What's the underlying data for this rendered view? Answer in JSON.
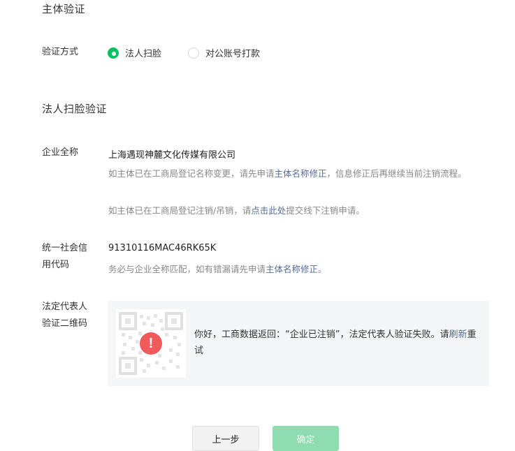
{
  "header": {
    "title": "主体验证"
  },
  "verify_method": {
    "label": "验证方式",
    "options": [
      {
        "label": "法人扫脸",
        "selected": true
      },
      {
        "label": "对公账号打款",
        "selected": false
      }
    ]
  },
  "face_scan": {
    "title": "法人扫脸验证",
    "company": {
      "label": "企业全称",
      "value": "上海遇现神麓文化传媒有限公司",
      "hint1_prefix": "如主体已在工商局登记名称变更，请先申请",
      "hint1_link": "主体名称修正",
      "hint1_suffix": "，信息修正后再继续当前注销流程。",
      "hint2_prefix": "如主体已在工商局登记注销/吊销，请",
      "hint2_link": "点击此处",
      "hint2_suffix": "提交线下注销申请。"
    },
    "credit_code": {
      "label_line1": "统一社会信",
      "label_line2": "用代码",
      "value": "91310116MAC46RK65K",
      "hint_prefix": "务必与企业全称匹配，如有错漏请先申请",
      "hint_link": "主体名称修正",
      "hint_suffix": "。"
    },
    "qr": {
      "label_line1": "法定代表人",
      "label_line2": "验证二维码",
      "warning_icon": "exclamation-circle-icon",
      "message": "你好，工商数据返回：“企业已注销”，法定代表人验证失败。请",
      "refresh_link": "刷新",
      "retry": "重试"
    }
  },
  "footer": {
    "prev_label": "上一步",
    "confirm_label": "确定"
  },
  "colors": {
    "accent": "#07c160",
    "link": "#576b95",
    "warning": "#f05a5a",
    "confirm_disabled": "#8fdcb0"
  }
}
